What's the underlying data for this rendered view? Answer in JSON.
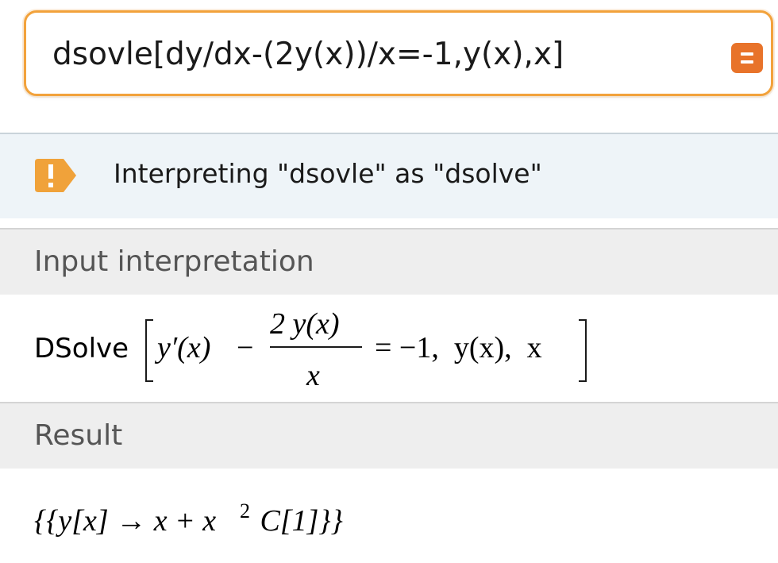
{
  "search": {
    "query": "dsovle[dy/dx-(2y(x))/x=-1,y(x),x]"
  },
  "notice": {
    "icon": "warning-icon",
    "text": "Interpreting \"dsovle\" as \"dsolve\"",
    "icon_color": "#f0a23a"
  },
  "input_pod": {
    "title": "Input interpretation",
    "function_name": "DSolve",
    "term1": "y′(x)",
    "minus": "−",
    "numerator": "2 y(x)",
    "denominator": "x",
    "rest": "= −1,  y(x),  x"
  },
  "result_pod": {
    "title": "Result",
    "lhs": "{{y[x] → x + x",
    "exponent": "2",
    "rhs": " C[1]}}"
  },
  "colors": {
    "accent": "#e8732a",
    "search_border": "#f2a23b",
    "notice_bg": "#eef4f8",
    "pod_title_bg": "#eeeeee"
  }
}
